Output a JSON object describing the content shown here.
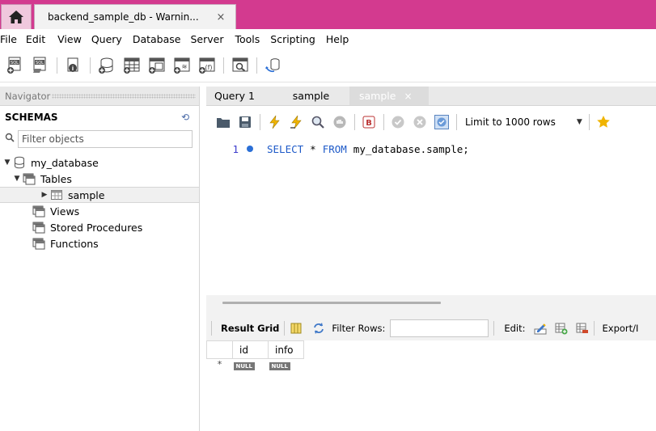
{
  "window": {
    "tab_title": "backend_sample_db - Warnin...",
    "tab_close": "×"
  },
  "menu": [
    "File",
    "Edit",
    "View",
    "Query",
    "Database",
    "Server",
    "Tools",
    "Scripting",
    "Help"
  ],
  "navigator": {
    "header": "Navigator",
    "schemas_label": "SCHEMAS",
    "filter_placeholder": "Filter objects",
    "tree": {
      "database": "my_database",
      "tables": "Tables",
      "table_sample": "sample",
      "views": "Views",
      "stored_procedures": "Stored Procedures",
      "functions": "Functions"
    }
  },
  "editor_tabs": [
    {
      "label": "Query 1"
    },
    {
      "label": "sample"
    },
    {
      "label": "sample",
      "close": "×"
    }
  ],
  "sql_toolbar": {
    "limit_label": "Limit to 1000 rows"
  },
  "editor": {
    "line_number": "1",
    "kw_select": "SELECT",
    "star": "*",
    "kw_from": "FROM",
    "table_ref": "my_database.sample;"
  },
  "result": {
    "grid_label": "Result Grid",
    "filter_label": "Filter Rows:",
    "edit_label": "Edit:",
    "export_label": "Export/I",
    "columns": [
      "id",
      "info"
    ],
    "null_value": "NULL",
    "new_row_marker": "*"
  },
  "colors": {
    "titlebar": "#d33a8f",
    "keyword": "#1e5ac8",
    "active_tab": "#dcdcdc"
  }
}
